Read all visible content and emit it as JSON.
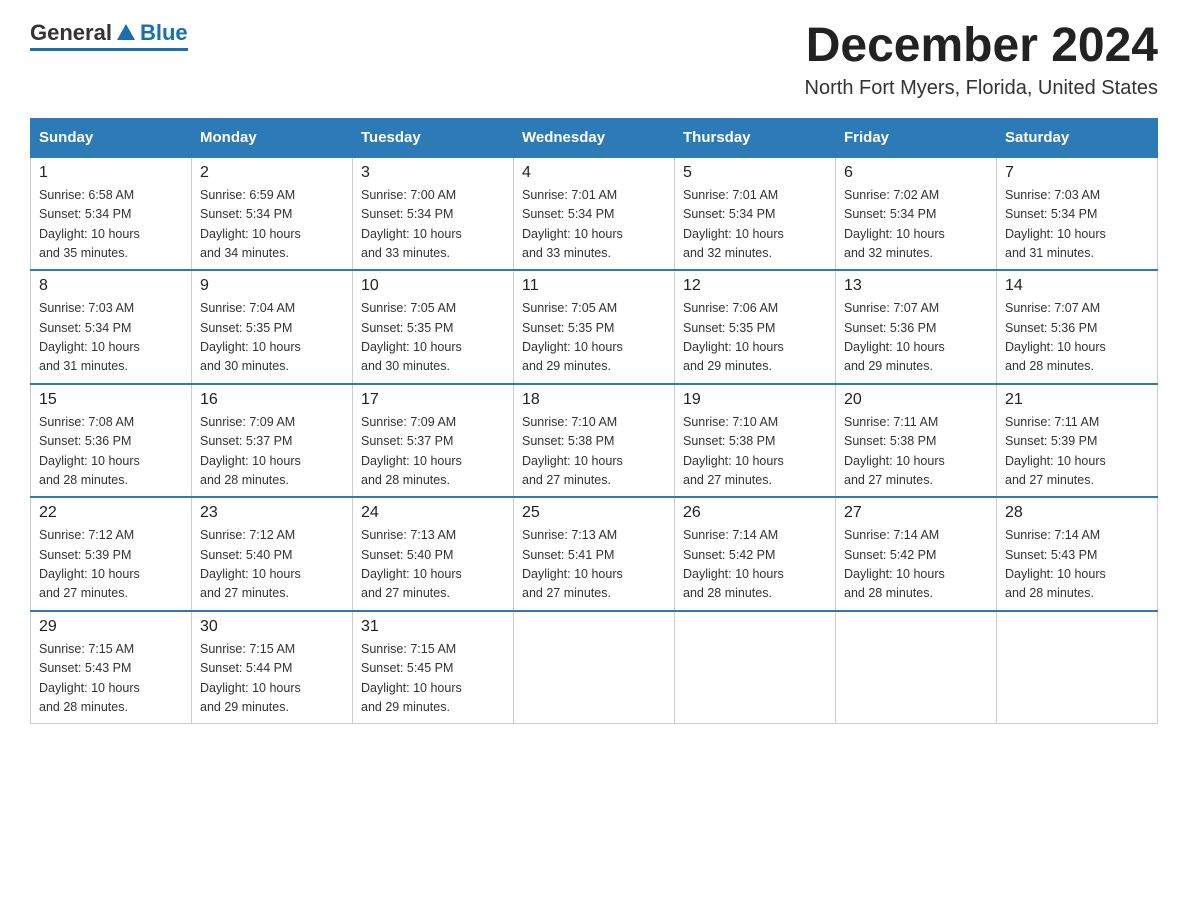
{
  "header": {
    "logo_general": "General",
    "logo_blue": "Blue",
    "month_title": "December 2024",
    "location": "North Fort Myers, Florida, United States"
  },
  "days_of_week": [
    "Sunday",
    "Monday",
    "Tuesday",
    "Wednesday",
    "Thursday",
    "Friday",
    "Saturday"
  ],
  "weeks": [
    [
      {
        "day": "1",
        "sunrise": "6:58 AM",
        "sunset": "5:34 PM",
        "daylight": "10 hours and 35 minutes."
      },
      {
        "day": "2",
        "sunrise": "6:59 AM",
        "sunset": "5:34 PM",
        "daylight": "10 hours and 34 minutes."
      },
      {
        "day": "3",
        "sunrise": "7:00 AM",
        "sunset": "5:34 PM",
        "daylight": "10 hours and 33 minutes."
      },
      {
        "day": "4",
        "sunrise": "7:01 AM",
        "sunset": "5:34 PM",
        "daylight": "10 hours and 33 minutes."
      },
      {
        "day": "5",
        "sunrise": "7:01 AM",
        "sunset": "5:34 PM",
        "daylight": "10 hours and 32 minutes."
      },
      {
        "day": "6",
        "sunrise": "7:02 AM",
        "sunset": "5:34 PM",
        "daylight": "10 hours and 32 minutes."
      },
      {
        "day": "7",
        "sunrise": "7:03 AM",
        "sunset": "5:34 PM",
        "daylight": "10 hours and 31 minutes."
      }
    ],
    [
      {
        "day": "8",
        "sunrise": "7:03 AM",
        "sunset": "5:34 PM",
        "daylight": "10 hours and 31 minutes."
      },
      {
        "day": "9",
        "sunrise": "7:04 AM",
        "sunset": "5:35 PM",
        "daylight": "10 hours and 30 minutes."
      },
      {
        "day": "10",
        "sunrise": "7:05 AM",
        "sunset": "5:35 PM",
        "daylight": "10 hours and 30 minutes."
      },
      {
        "day": "11",
        "sunrise": "7:05 AM",
        "sunset": "5:35 PM",
        "daylight": "10 hours and 29 minutes."
      },
      {
        "day": "12",
        "sunrise": "7:06 AM",
        "sunset": "5:35 PM",
        "daylight": "10 hours and 29 minutes."
      },
      {
        "day": "13",
        "sunrise": "7:07 AM",
        "sunset": "5:36 PM",
        "daylight": "10 hours and 29 minutes."
      },
      {
        "day": "14",
        "sunrise": "7:07 AM",
        "sunset": "5:36 PM",
        "daylight": "10 hours and 28 minutes."
      }
    ],
    [
      {
        "day": "15",
        "sunrise": "7:08 AM",
        "sunset": "5:36 PM",
        "daylight": "10 hours and 28 minutes."
      },
      {
        "day": "16",
        "sunrise": "7:09 AM",
        "sunset": "5:37 PM",
        "daylight": "10 hours and 28 minutes."
      },
      {
        "day": "17",
        "sunrise": "7:09 AM",
        "sunset": "5:37 PM",
        "daylight": "10 hours and 28 minutes."
      },
      {
        "day": "18",
        "sunrise": "7:10 AM",
        "sunset": "5:38 PM",
        "daylight": "10 hours and 27 minutes."
      },
      {
        "day": "19",
        "sunrise": "7:10 AM",
        "sunset": "5:38 PM",
        "daylight": "10 hours and 27 minutes."
      },
      {
        "day": "20",
        "sunrise": "7:11 AM",
        "sunset": "5:38 PM",
        "daylight": "10 hours and 27 minutes."
      },
      {
        "day": "21",
        "sunrise": "7:11 AM",
        "sunset": "5:39 PM",
        "daylight": "10 hours and 27 minutes."
      }
    ],
    [
      {
        "day": "22",
        "sunrise": "7:12 AM",
        "sunset": "5:39 PM",
        "daylight": "10 hours and 27 minutes."
      },
      {
        "day": "23",
        "sunrise": "7:12 AM",
        "sunset": "5:40 PM",
        "daylight": "10 hours and 27 minutes."
      },
      {
        "day": "24",
        "sunrise": "7:13 AM",
        "sunset": "5:40 PM",
        "daylight": "10 hours and 27 minutes."
      },
      {
        "day": "25",
        "sunrise": "7:13 AM",
        "sunset": "5:41 PM",
        "daylight": "10 hours and 27 minutes."
      },
      {
        "day": "26",
        "sunrise": "7:14 AM",
        "sunset": "5:42 PM",
        "daylight": "10 hours and 28 minutes."
      },
      {
        "day": "27",
        "sunrise": "7:14 AM",
        "sunset": "5:42 PM",
        "daylight": "10 hours and 28 minutes."
      },
      {
        "day": "28",
        "sunrise": "7:14 AM",
        "sunset": "5:43 PM",
        "daylight": "10 hours and 28 minutes."
      }
    ],
    [
      {
        "day": "29",
        "sunrise": "7:15 AM",
        "sunset": "5:43 PM",
        "daylight": "10 hours and 28 minutes."
      },
      {
        "day": "30",
        "sunrise": "7:15 AM",
        "sunset": "5:44 PM",
        "daylight": "10 hours and 29 minutes."
      },
      {
        "day": "31",
        "sunrise": "7:15 AM",
        "sunset": "5:45 PM",
        "daylight": "10 hours and 29 minutes."
      },
      null,
      null,
      null,
      null
    ]
  ],
  "labels": {
    "sunrise": "Sunrise:",
    "sunset": "Sunset:",
    "daylight": "Daylight:"
  }
}
